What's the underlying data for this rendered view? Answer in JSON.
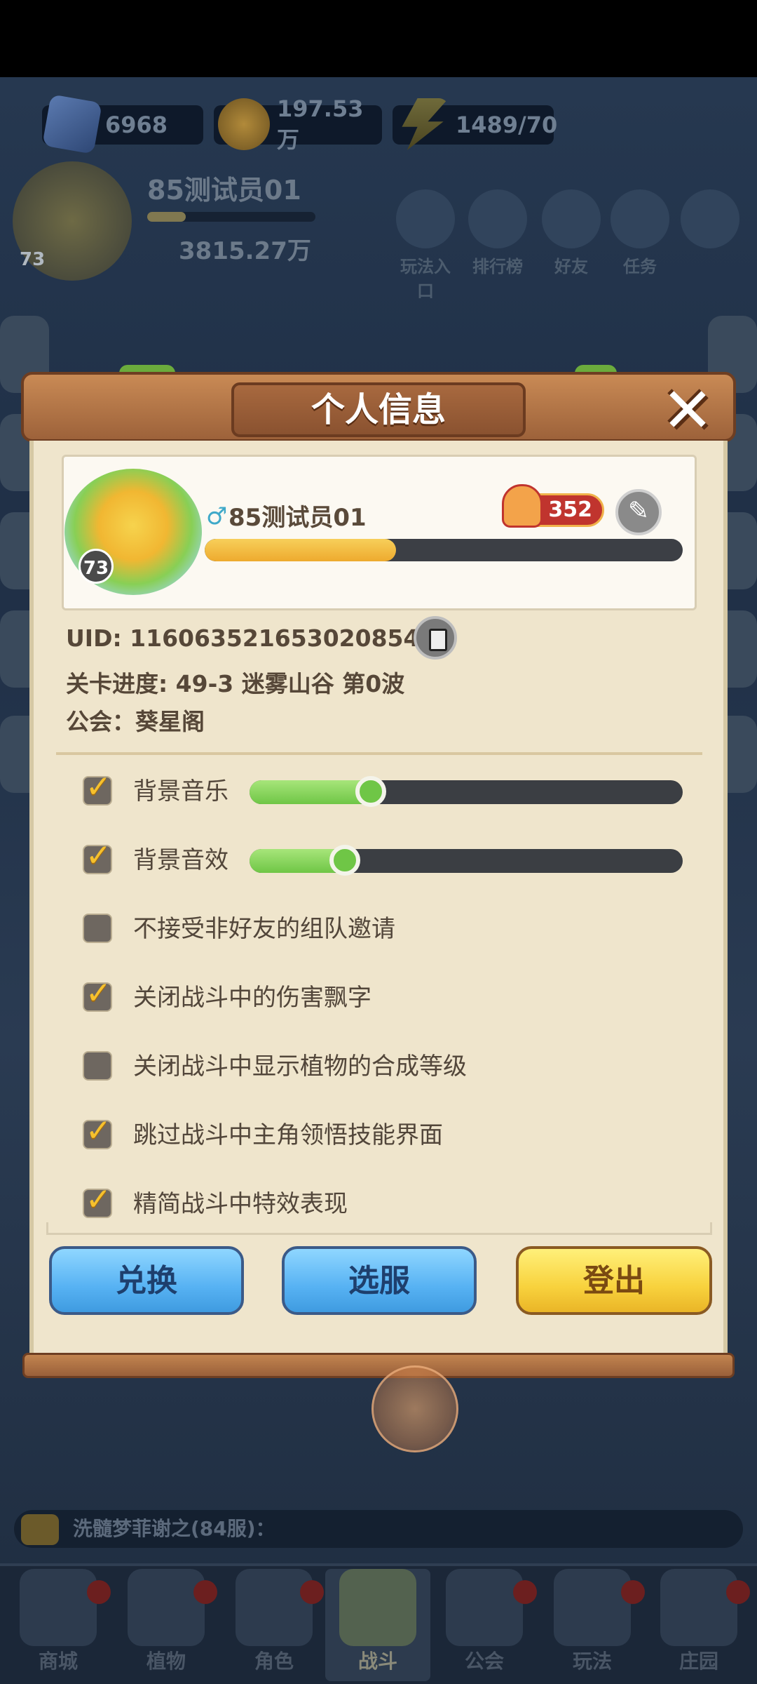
{
  "hud": {
    "gems": "6968",
    "gold": "197.53万",
    "energy": "1489/70",
    "player_name": "85测试员01",
    "level": "73",
    "power": "3815.27万",
    "buttons": [
      "玩法入口",
      "排行榜",
      "好友",
      "任务",
      ""
    ]
  },
  "panel": {
    "title": "个人信息",
    "close_glyph": "✕",
    "profile": {
      "level": "73",
      "gender_glyph": "♂",
      "name": "85测试员01",
      "likes": "352",
      "xp_progress": 0.4,
      "edit_glyph": "✎"
    },
    "uid": "UID: 1160635216530208545",
    "stage": "关卡进度: 49-3  迷雾山谷 第0波",
    "guild": "公会：葵星阁",
    "options": [
      {
        "label": "背景音乐",
        "checked": true,
        "slider": 0.28
      },
      {
        "label": "背景音效",
        "checked": true,
        "slider": 0.22
      },
      {
        "label": "不接受非好友的组队邀请",
        "checked": false
      },
      {
        "label": "关闭战斗中的伤害飘字",
        "checked": true
      },
      {
        "label": "关闭战斗中显示植物的合成等级",
        "checked": false
      },
      {
        "label": "跳过战斗中主角领悟技能界面",
        "checked": true
      },
      {
        "label": "精简战斗中特效表现",
        "checked": true
      }
    ],
    "buttons": {
      "exchange": "兑换",
      "server": "选服",
      "logout": "登出"
    }
  },
  "chat": {
    "text": "洗髓梦菲谢之(84服)："
  },
  "nav": [
    "商城",
    "植物",
    "角色",
    "战斗",
    "公会",
    "玩法",
    "庄园"
  ],
  "colors": {
    "panel_wood": "#b87545",
    "panel_body": "#efe5cc",
    "slider_fill": "#6fc646",
    "checkbox_on": "#f6c12d",
    "button_blue": "#57b2f3",
    "button_yellow": "#f8d23d"
  }
}
